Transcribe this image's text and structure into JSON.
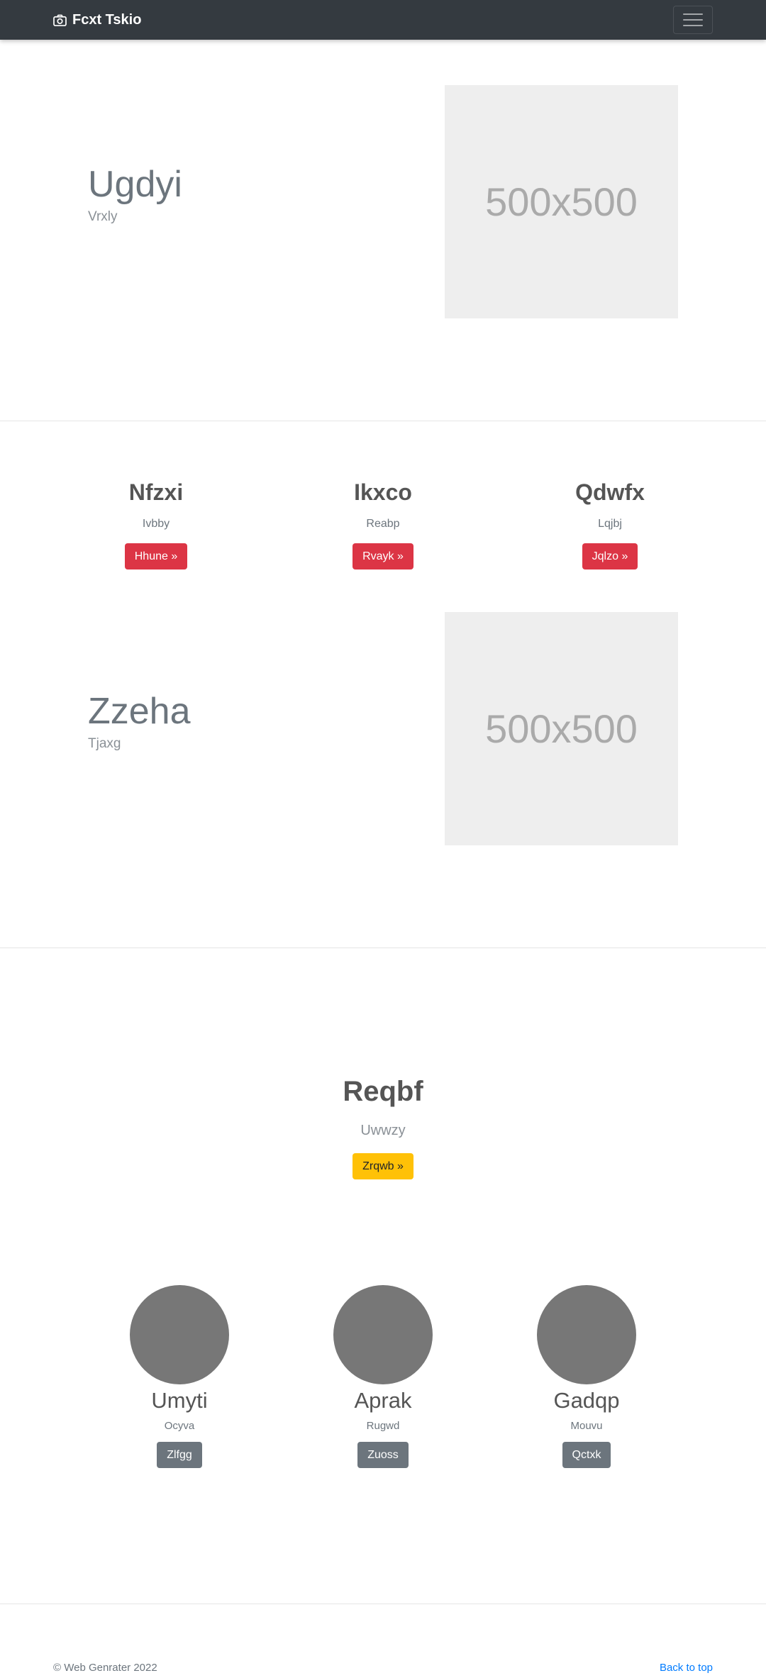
{
  "navbar": {
    "brand": "Fcxt Tskio",
    "brand_icon": "camera-icon",
    "toggler_icon": "hamburger-menu-icon"
  },
  "hero1": {
    "title": "Ugdyi",
    "subtitle": "Vrxly",
    "image_label": "500x500"
  },
  "features": [
    {
      "title": "Nfzxi",
      "text": "Ivbby",
      "button": "Hhune »"
    },
    {
      "title": "Ikxco",
      "text": "Reabp",
      "button": "Rvayk »"
    },
    {
      "title": "Qdwfx",
      "text": "Lqjbj",
      "button": "Jqlzo »"
    }
  ],
  "hero2": {
    "title": "Zzeha",
    "subtitle": "Tjaxg",
    "image_label": "500x500"
  },
  "cta": {
    "title": "Reqbf",
    "subtitle": "Uwwzy",
    "button": "Zrqwb »"
  },
  "team": [
    {
      "name": "Umyti",
      "role": "Ocyva",
      "button": "Zlfgg"
    },
    {
      "name": "Aprak",
      "role": "Rugwd",
      "button": "Zuoss"
    },
    {
      "name": "Gadqp",
      "role": "Mouvu",
      "button": "Qctxk"
    }
  ],
  "footer": {
    "copyright": "© Web Genrater 2022",
    "back_to_top": "Back to top"
  },
  "colors": {
    "navbar_bg": "#343a40",
    "danger": "#dc3545",
    "warning": "#ffc107",
    "secondary": "#6c757d",
    "link": "#007bff"
  }
}
